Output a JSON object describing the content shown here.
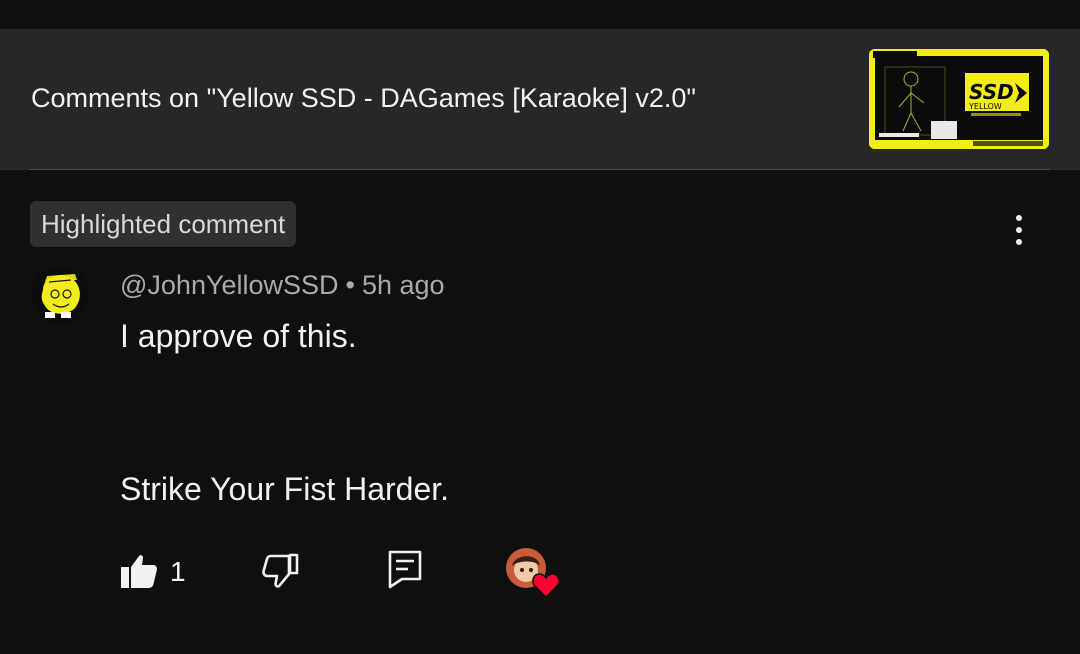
{
  "header": {
    "title": "Comments on \"Yellow SSD - DAGames [Karaoke] v2.0\"",
    "thumbnail_icon": "video-thumbnail",
    "thumbnail_text_top": "SSD",
    "thumbnail_text_bottom": "YELLOW"
  },
  "comment": {
    "badge": "Highlighted comment",
    "author": "@JohnYellowSSD",
    "separator": "•",
    "time": "5h ago",
    "lines": [
      "I approve of this.",
      "Strike Your Fist Harder."
    ],
    "like_count": "1",
    "icons": {
      "more": "more-vert-icon",
      "like": "thumb-up-icon",
      "dislike": "thumb-down-icon",
      "reply": "reply-icon",
      "creator_heart": "heart-icon"
    }
  },
  "colors": {
    "background": "#0f0f0f",
    "header_bg": "#272727",
    "accent_yellow": "#f2ec1b",
    "heart_red": "#ff0033",
    "secondary_text": "#aaaaaa"
  }
}
